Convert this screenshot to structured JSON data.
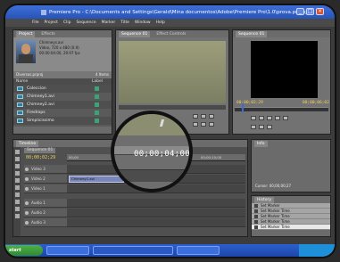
{
  "window": {
    "title": "Premiere Pro - C:\\Documents and Settings\\Gerald\\Mina documentos\\Adobe\\Premiere Pro\\1.0\\prova.prproj *"
  },
  "menu": [
    "File",
    "Project",
    "Clip",
    "Sequence",
    "Marker",
    "Title",
    "Window",
    "Help"
  ],
  "project": {
    "tab": "Project",
    "tab2": "Effects",
    "file_name": "Chimneys.avi",
    "file_info": "Video, 720 x 480 (0.9)",
    "file_duration": "00:00:04:00, 29.97 fps",
    "bin_name": "Diversos.prproj",
    "items_count": "4 Items",
    "col_name": "Name",
    "col_label": "Label",
    "items": [
      "Coleccion",
      "Chimney1.avi",
      "Chimney2.avi",
      "Firedrops",
      "Simplicissimo"
    ]
  },
  "source": {
    "tab": "Sequence 01",
    "tab2": "Effect Controls"
  },
  "program": {
    "tab": "Sequence 01",
    "tc_left": "00;00;02;29",
    "tc_right": "00;00;06;02"
  },
  "timeline": {
    "tab": "Timeline",
    "sequence_tab": "Sequence 01",
    "timecode": "00;00;02;29",
    "ruler_labels": [
      "00;00",
      "00;00;05;00",
      "00;00;10;00"
    ],
    "tracks": [
      {
        "name": "Video 3",
        "clip": ""
      },
      {
        "name": "Video 2",
        "clip": "Chimney1.avi"
      },
      {
        "name": "Video 1",
        "clip": ""
      },
      {
        "name": "Audio 1",
        "clip": ""
      },
      {
        "name": "Audio 2",
        "clip": ""
      },
      {
        "name": "Audio 3",
        "clip": ""
      }
    ]
  },
  "magnifier": {
    "timecode": "00;00;04;00"
  },
  "info": {
    "tab": "Info",
    "cursor": "Cursor: 00;00;00;27"
  },
  "history": {
    "tab": "History",
    "rows": [
      "Set Marker",
      "Set Marker Time",
      "Set Marker Time",
      "Set Marker Time",
      "Set Marker Time"
    ]
  },
  "taskbar": {
    "start": "start"
  }
}
